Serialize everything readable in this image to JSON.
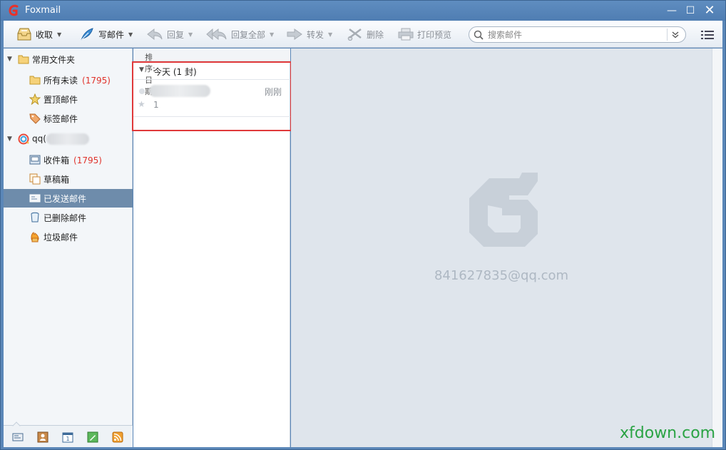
{
  "window": {
    "title": "Foxmail",
    "minimize_glyph": "—",
    "maximize_glyph": "☐",
    "close_glyph": "✕"
  },
  "toolbar": {
    "receive": "收取",
    "compose": "写邮件",
    "reply": "回复",
    "reply_all": "回复全部",
    "forward": "转发",
    "delete": "删除",
    "print_preview": "打印预览",
    "search_placeholder": "搜索邮件"
  },
  "sidebar": {
    "common_folders": "常用文件夹",
    "all_unread": "所有未读",
    "all_unread_count": "(1795)",
    "pinned": "置顶邮件",
    "tagged": "标签邮件",
    "account_prefix": "qq(",
    "inbox": "收件箱",
    "inbox_count": "(1795)",
    "drafts": "草稿箱",
    "sent": "已发送邮件",
    "deleted": "已删除邮件",
    "junk": "垃圾邮件"
  },
  "maillist": {
    "sort_label": "排序:日期",
    "group_label": "今天 (1 封)",
    "mail": {
      "time": "刚刚",
      "subject": "1"
    }
  },
  "reading": {
    "account_email": "841627835@qq.com"
  },
  "site_watermark": "xfdown.com",
  "colors": {
    "title_bar": "#5b87b8",
    "selected_folder": "#6e8cab",
    "unread_count": "#e0322b",
    "highlight_border": "#e0393a",
    "reading_bg": "#dfe5ec",
    "site_watermark": "#2aa344"
  }
}
